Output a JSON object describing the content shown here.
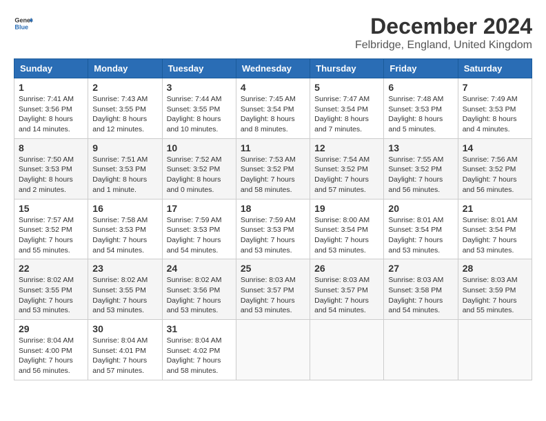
{
  "header": {
    "logo_line1": "General",
    "logo_line2": "Blue",
    "title": "December 2024",
    "subtitle": "Felbridge, England, United Kingdom"
  },
  "columns": [
    "Sunday",
    "Monday",
    "Tuesday",
    "Wednesday",
    "Thursday",
    "Friday",
    "Saturday"
  ],
  "weeks": [
    [
      {
        "day": "1",
        "rise": "7:41 AM",
        "set": "3:56 PM",
        "daylight": "8 hours and 14 minutes."
      },
      {
        "day": "2",
        "rise": "7:43 AM",
        "set": "3:55 PM",
        "daylight": "8 hours and 12 minutes."
      },
      {
        "day": "3",
        "rise": "7:44 AM",
        "set": "3:55 PM",
        "daylight": "8 hours and 10 minutes."
      },
      {
        "day": "4",
        "rise": "7:45 AM",
        "set": "3:54 PM",
        "daylight": "8 hours and 8 minutes."
      },
      {
        "day": "5",
        "rise": "7:47 AM",
        "set": "3:54 PM",
        "daylight": "8 hours and 7 minutes."
      },
      {
        "day": "6",
        "rise": "7:48 AM",
        "set": "3:53 PM",
        "daylight": "8 hours and 5 minutes."
      },
      {
        "day": "7",
        "rise": "7:49 AM",
        "set": "3:53 PM",
        "daylight": "8 hours and 4 minutes."
      }
    ],
    [
      {
        "day": "8",
        "rise": "7:50 AM",
        "set": "3:53 PM",
        "daylight": "8 hours and 2 minutes."
      },
      {
        "day": "9",
        "rise": "7:51 AM",
        "set": "3:53 PM",
        "daylight": "8 hours and 1 minute."
      },
      {
        "day": "10",
        "rise": "7:52 AM",
        "set": "3:52 PM",
        "daylight": "8 hours and 0 minutes."
      },
      {
        "day": "11",
        "rise": "7:53 AM",
        "set": "3:52 PM",
        "daylight": "7 hours and 58 minutes."
      },
      {
        "day": "12",
        "rise": "7:54 AM",
        "set": "3:52 PM",
        "daylight": "7 hours and 57 minutes."
      },
      {
        "day": "13",
        "rise": "7:55 AM",
        "set": "3:52 PM",
        "daylight": "7 hours and 56 minutes."
      },
      {
        "day": "14",
        "rise": "7:56 AM",
        "set": "3:52 PM",
        "daylight": "7 hours and 56 minutes."
      }
    ],
    [
      {
        "day": "15",
        "rise": "7:57 AM",
        "set": "3:52 PM",
        "daylight": "7 hours and 55 minutes."
      },
      {
        "day": "16",
        "rise": "7:58 AM",
        "set": "3:53 PM",
        "daylight": "7 hours and 54 minutes."
      },
      {
        "day": "17",
        "rise": "7:59 AM",
        "set": "3:53 PM",
        "daylight": "7 hours and 54 minutes."
      },
      {
        "day": "18",
        "rise": "7:59 AM",
        "set": "3:53 PM",
        "daylight": "7 hours and 53 minutes."
      },
      {
        "day": "19",
        "rise": "8:00 AM",
        "set": "3:54 PM",
        "daylight": "7 hours and 53 minutes."
      },
      {
        "day": "20",
        "rise": "8:01 AM",
        "set": "3:54 PM",
        "daylight": "7 hours and 53 minutes."
      },
      {
        "day": "21",
        "rise": "8:01 AM",
        "set": "3:54 PM",
        "daylight": "7 hours and 53 minutes."
      }
    ],
    [
      {
        "day": "22",
        "rise": "8:02 AM",
        "set": "3:55 PM",
        "daylight": "7 hours and 53 minutes."
      },
      {
        "day": "23",
        "rise": "8:02 AM",
        "set": "3:55 PM",
        "daylight": "7 hours and 53 minutes."
      },
      {
        "day": "24",
        "rise": "8:02 AM",
        "set": "3:56 PM",
        "daylight": "7 hours and 53 minutes."
      },
      {
        "day": "25",
        "rise": "8:03 AM",
        "set": "3:57 PM",
        "daylight": "7 hours and 53 minutes."
      },
      {
        "day": "26",
        "rise": "8:03 AM",
        "set": "3:57 PM",
        "daylight": "7 hours and 54 minutes."
      },
      {
        "day": "27",
        "rise": "8:03 AM",
        "set": "3:58 PM",
        "daylight": "7 hours and 54 minutes."
      },
      {
        "day": "28",
        "rise": "8:03 AM",
        "set": "3:59 PM",
        "daylight": "7 hours and 55 minutes."
      }
    ],
    [
      {
        "day": "29",
        "rise": "8:04 AM",
        "set": "4:00 PM",
        "daylight": "7 hours and 56 minutes."
      },
      {
        "day": "30",
        "rise": "8:04 AM",
        "set": "4:01 PM",
        "daylight": "7 hours and 57 minutes."
      },
      {
        "day": "31",
        "rise": "8:04 AM",
        "set": "4:02 PM",
        "daylight": "7 hours and 58 minutes."
      },
      null,
      null,
      null,
      null
    ]
  ]
}
